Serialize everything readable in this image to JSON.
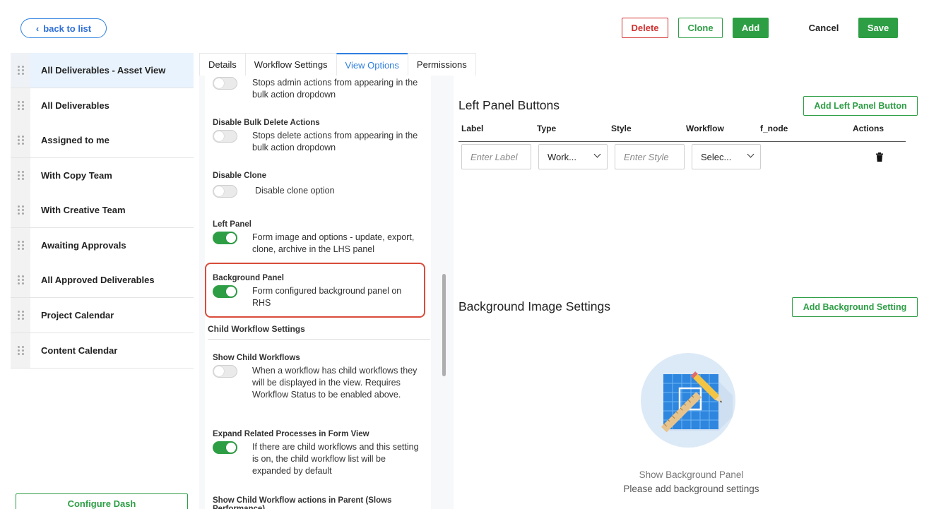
{
  "header": {
    "back_label": "back to list",
    "delete_label": "Delete",
    "clone_label": "Clone",
    "add_label": "Add",
    "cancel_label": "Cancel",
    "save_label": "Save"
  },
  "sidebar": {
    "items": [
      {
        "label": "All Deliverables - Asset View",
        "active": true
      },
      {
        "label": "All Deliverables"
      },
      {
        "label": "Assigned to me"
      },
      {
        "label": "With Copy Team"
      },
      {
        "label": "With Creative Team"
      },
      {
        "label": "Awaiting Approvals"
      },
      {
        "label": "All Approved Deliverables"
      },
      {
        "label": "Project Calendar"
      },
      {
        "label": "Content Calendar"
      }
    ],
    "configure_label": "Configure Dash"
  },
  "tabs": [
    {
      "label": "Details"
    },
    {
      "label": "Workflow Settings"
    },
    {
      "label": "View Options",
      "active": true
    },
    {
      "label": "Permissions"
    }
  ],
  "settings": {
    "top_partial": {
      "desc": "Stops admin actions from appearing in the bulk action dropdown",
      "on": false
    },
    "disable_bulk_delete": {
      "title": "Disable Bulk Delete Actions",
      "desc": "Stops delete actions from appearing in the bulk action dropdown",
      "on": false
    },
    "disable_clone": {
      "title": "Disable Clone",
      "desc": "Disable clone option",
      "on": false
    },
    "left_panel": {
      "title": "Left Panel",
      "desc": "Form image and options - update, export, clone, archive in the LHS panel",
      "on": true
    },
    "background_panel": {
      "title": "Background Panel",
      "desc": "Form configured background panel on RHS",
      "on": true
    },
    "child_section_title": "Child Workflow Settings",
    "show_child": {
      "title": "Show Child Workflows",
      "desc": "When a workflow has child workflows they will be displayed in the view. Requires Workflow Status to be enabled above.",
      "on": false
    },
    "expand_related": {
      "title": "Expand Related Processes in Form View",
      "desc": "If there are child workflows and this setting is on, the child workflow list will be expanded by default",
      "on": true
    },
    "show_child_actions": {
      "title": "Show Child Workflow actions in Parent (Slows Performance)"
    }
  },
  "left_panel_buttons": {
    "title": "Left Panel Buttons",
    "add_label": "Add Left Panel Button",
    "columns": [
      "Label",
      "Type",
      "Style",
      "Workflow",
      "f_node",
      "Actions"
    ],
    "row": {
      "label_placeholder": "Enter Label",
      "type_value": "Work...",
      "style_placeholder": "Enter Style",
      "workflow_value": "Selec..."
    }
  },
  "background_settings": {
    "title": "Background Image Settings",
    "add_label": "Add Background Setting",
    "empty_line1": "Show Background Panel",
    "empty_line2": "Please add background settings"
  },
  "colors": {
    "accent_blue": "#2f7fe0",
    "green": "#2e9e45",
    "red": "#d0302f"
  }
}
